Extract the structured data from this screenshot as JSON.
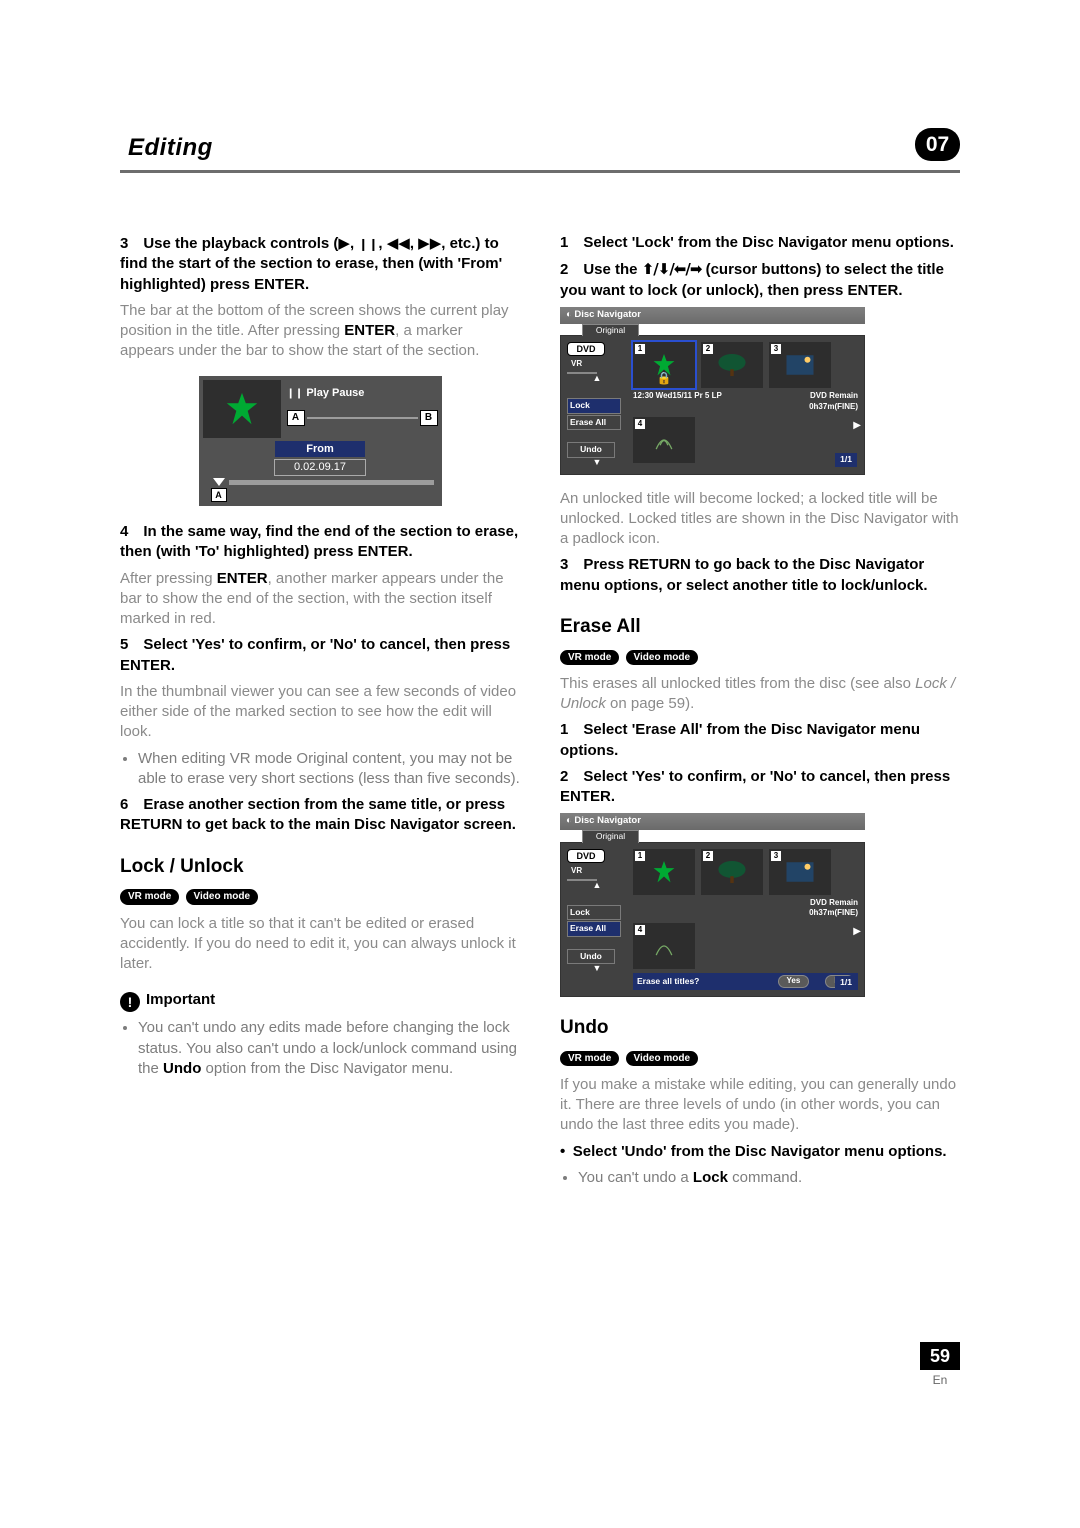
{
  "header": {
    "title": "Editing",
    "chapter": "07"
  },
  "footer": {
    "page": "59",
    "lang": "En"
  },
  "badges": {
    "vr": "VR mode",
    "video": "Video mode"
  },
  "left": {
    "s3a": "3 Use the playback controls (",
    "s3b": ", etc.) to find the start of the section to erase, then (with 'From' highlighted) press ENTER.",
    "p1a": "The bar at the bottom of the screen shows the current play position in the title. After pressing ",
    "p1b": "ENTER",
    "p1c": ", a marker appears under the bar to show the start of the section.",
    "fig1": {
      "play": "Play Pause",
      "A": "A",
      "B": "B",
      "from": "From",
      "time": "0.02.09.17"
    },
    "s4": "4 In the same way, find the end of the section to erase, then (with 'To' highlighted) press ENTER.",
    "p2a": "After pressing ",
    "p2b": "ENTER",
    "p2c": ", another marker appears under the bar to show the end of the section, with the section itself marked in red.",
    "s5": "5 Select 'Yes' to confirm, or 'No' to cancel, then press ENTER.",
    "p3": "In the thumbnail viewer you can see a few seconds of video either side of the marked section to see how the edit will look.",
    "b1": "When editing VR mode Original content, you may not be able to erase very short sections (less than five seconds).",
    "s6": "6 Erase another section from the same title, or press RETURN to get back to the main Disc Navigator screen.",
    "h_lock": "Lock / Unlock",
    "p4": "You can lock a title so that it can't be edited or erased accidently. If you do need to edit it, you can always unlock it later.",
    "imp": "Important",
    "b2a": "You can't undo any edits made before changing the lock status. You also can't undo a lock/unlock command using the ",
    "b2b": "Undo",
    "b2c": " option from the Disc Navigator menu."
  },
  "right": {
    "s1": "1 Select 'Lock' from the Disc Navigator menu options.",
    "s2a": "2 Use the ",
    "s2b": " (cursor buttons) to select the title you want to lock (or unlock), then press ENTER.",
    "nav": {
      "title": "Disc Navigator",
      "original": "Original",
      "dvd": "DVD",
      "vr": "VR",
      "lock": "Lock",
      "eraseall": "Erase All",
      "undo": "Undo",
      "info": "12:30 Wed15/11  Pr 5  LP",
      "remain1": "DVD Remain",
      "remain2": "0h37m(FINE)",
      "pg": "1/1",
      "n1": "1",
      "n2": "2",
      "n3": "3",
      "n4": "4",
      "prompt": "Erase all titles?",
      "yes": "Yes",
      "no": "No"
    },
    "p1": "An unlocked title will become locked; a locked title will be unlocked. Locked titles are shown in the Disc Navigator with a padlock icon.",
    "s3": "3 Press RETURN to go back to the Disc Navigator menu options, or select another title to lock/unlock.",
    "h_erase": "Erase All",
    "p2a": "This erases all unlocked titles from the disc (see also ",
    "p2b": "Lock / Unlock",
    "p2c": " on page 59).",
    "s4": "1 Select 'Erase All' from the Disc Navigator menu options.",
    "s5": "2 Select 'Yes' to confirm, or 'No' to cancel, then press ENTER.",
    "h_undo": "Undo",
    "p3": "If you make a mistake while editing, you can generally undo it. There are three levels of undo (in other words, you can undo the last three edits you made).",
    "s6": "• Select 'Undo' from the Disc Navigator menu options.",
    "b1a": "You can't undo a ",
    "b1b": "Lock",
    "b1c": " command."
  },
  "symbols": {
    "play": "▶",
    "pause": "❙❙",
    "rew": "◀◀",
    "ff": "▶▶",
    "cursor": "⬆/⬇/⬅/➡",
    "padlock": "🔒",
    "exclaim": "!"
  }
}
